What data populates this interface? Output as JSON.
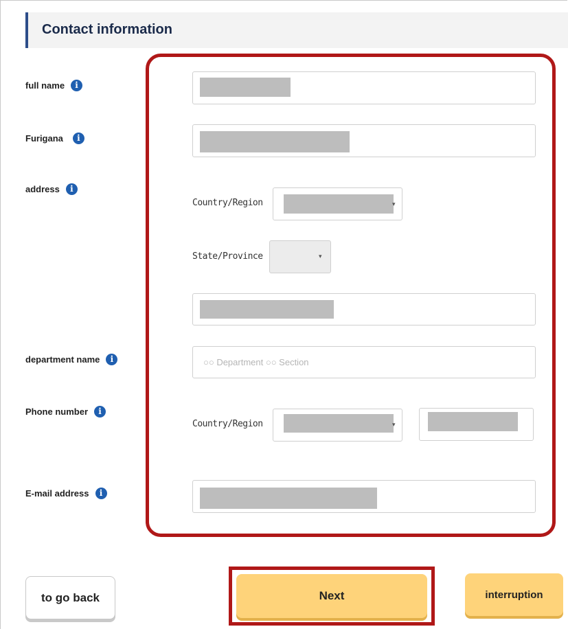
{
  "section": {
    "title": "Contact information"
  },
  "labels": {
    "full_name": "full name",
    "furigana": "Furigana",
    "address": "address",
    "department_name": "department name",
    "phone_number": "Phone number",
    "email": "E-mail address"
  },
  "info_icon_glyph": "i",
  "address": {
    "country_label": "Country/Region",
    "state_label": "State/Province",
    "caret": "▾"
  },
  "department": {
    "placeholder": "○○ Department ○○ Section"
  },
  "phone": {
    "country_label": "Country/Region",
    "caret": "▾"
  },
  "buttons": {
    "back": "to go back",
    "next": "Next",
    "interruption": "interruption"
  },
  "colors": {
    "accent_red": "#b01818",
    "info_blue": "#1f5fb0",
    "button_yellow": "#fed37a",
    "header_bar": "#2d4d8a"
  }
}
